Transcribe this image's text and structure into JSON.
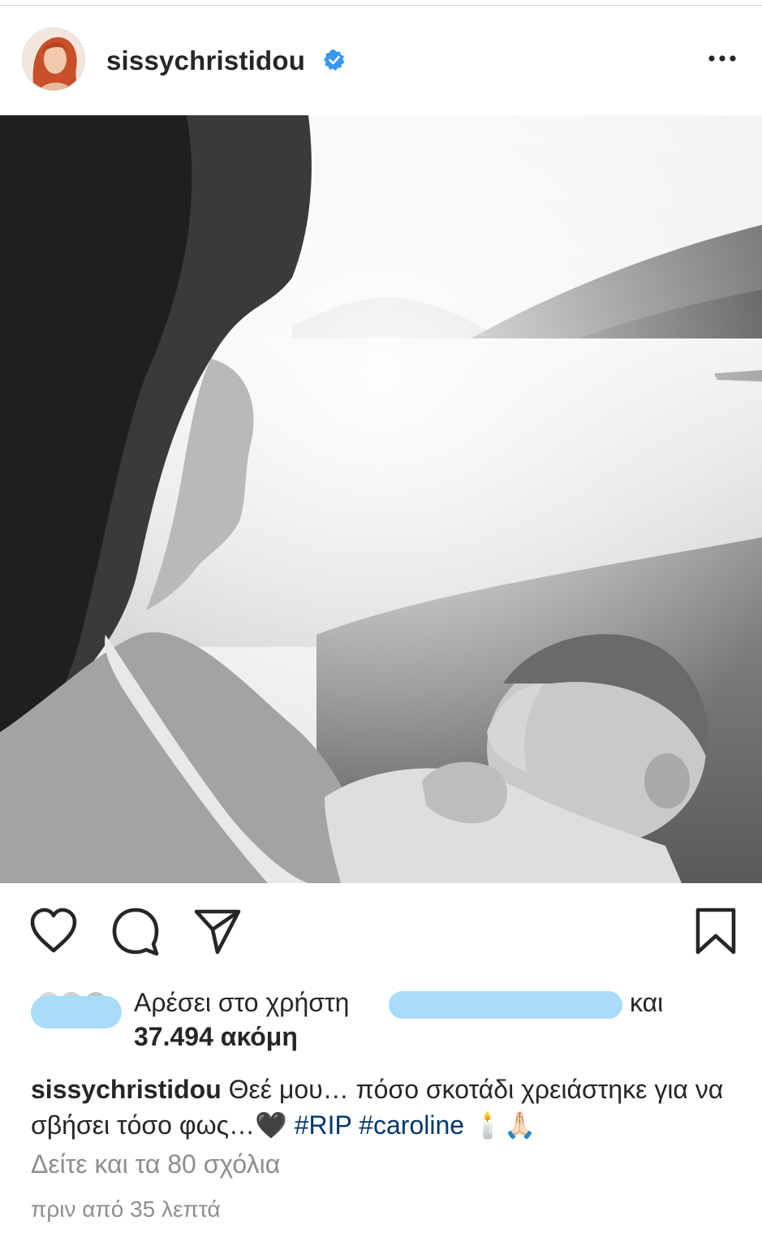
{
  "post": {
    "username": "sissychristidou",
    "verified_icon": "verified-badge-icon",
    "more_icon": "more-options-icon"
  },
  "actions": {
    "like_icon": "heart-icon",
    "comment_icon": "comment-icon",
    "share_icon": "send-icon",
    "save_icon": "bookmark-icon"
  },
  "likes": {
    "prefix": "Αρέσει στο χρήστη",
    "suffix": "και",
    "count": "37.494 ακόμη"
  },
  "caption": {
    "username": "sissychristidou",
    "text": "Θεέ μου… πόσο σκοτάδι χρειάστηκε για να σβήσει τόσο φως…🖤",
    "hashtags": [
      "#RIP",
      "#caroline"
    ],
    "emojis": "🕯️🙏🏻"
  },
  "comments_link": "Δείτε και τα 80 σχόλια",
  "timestamp": "πριν από 35 λεπτά",
  "colors": {
    "hashtag": "#00376b",
    "verified": "#3897f0",
    "muted": "#8e8e8e",
    "mask": "#a8dcf8"
  }
}
